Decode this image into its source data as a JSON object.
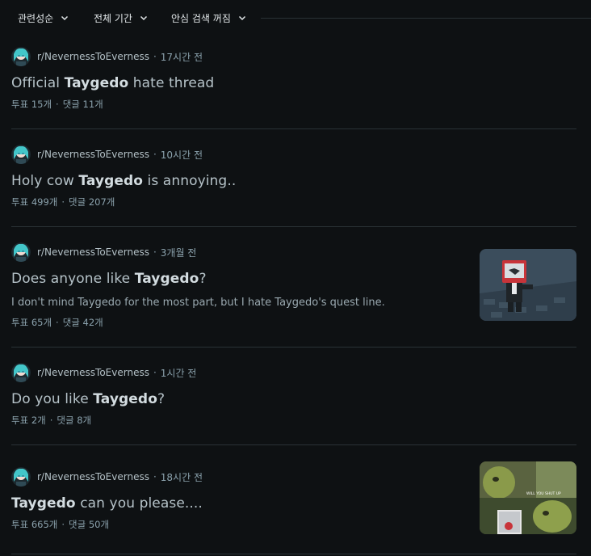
{
  "filters": {
    "sort": "관련성순",
    "time": "전체 기간",
    "safe_search": "안심 검색 꺼짐"
  },
  "posts": [
    {
      "subreddit": "r/NevernessToEverness",
      "time": "17시간 전",
      "title_pre": "Official ",
      "title_bold": "Taygedo",
      "title_post": " hate thread",
      "snippet": "",
      "votes": "투표 15개",
      "comments": "댓글 11개"
    },
    {
      "subreddit": "r/NevernessToEverness",
      "time": "10시간 전",
      "title_pre": "Holy cow ",
      "title_bold": "Taygedo",
      "title_post": " is annoying..",
      "snippet": "",
      "votes": "투표 499개",
      "comments": "댓글 207개"
    },
    {
      "subreddit": "r/NevernessToEverness",
      "time": "3개월 전",
      "title_pre": "Does anyone like ",
      "title_bold": "Taygedo",
      "title_post": "?",
      "snippet": "I don't mind Taygedo for the most part, but I hate Taygedo's quest line.",
      "votes": "투표 65개",
      "comments": "댓글 42개"
    },
    {
      "subreddit": "r/NevernessToEverness",
      "time": "1시간 전",
      "title_pre": "Do you like ",
      "title_bold": "Taygedo",
      "title_post": "?",
      "snippet": "",
      "votes": "투표 2개",
      "comments": "댓글 8개"
    },
    {
      "subreddit": "r/NevernessToEverness",
      "time": "18시간 전",
      "title_pre": "",
      "title_bold": "Taygedo",
      "title_post": " can you please....",
      "snippet": "",
      "votes": "투표 665개",
      "comments": "댓글 50개"
    }
  ],
  "thumbnails": {
    "post_3": "robot-character-thumbnail",
    "post_5": "shrek-meme-thumbnail",
    "post_5_caption": "WILL YOU SHUT UP"
  },
  "separator": "·"
}
